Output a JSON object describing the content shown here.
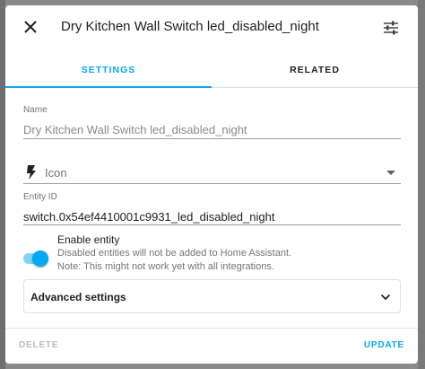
{
  "dialog": {
    "title": "Dry Kitchen Wall Switch led_disabled_night",
    "close_icon": "close-icon",
    "settings_icon": "tune-icon"
  },
  "tabs": [
    {
      "label": "SETTINGS",
      "active": true
    },
    {
      "label": "RELATED",
      "active": false
    }
  ],
  "form": {
    "name_label": "Name",
    "name_value": "Dry Kitchen Wall Switch led_disabled_night",
    "icon_field_icon": "lightning-bolt-icon",
    "icon_placeholder": "Icon",
    "entity_id_label": "Entity ID",
    "entity_id_value": "switch.0x54ef4410001c9931_led_disabled_night",
    "enable_entity": {
      "enabled": true,
      "label": "Enable entity",
      "description_1": "Disabled entities will not be added to Home Assistant.",
      "description_2": "Note: This might not work yet with all integrations."
    },
    "advanced_settings_label": "Advanced settings"
  },
  "footer": {
    "delete_label": "DELETE",
    "update_label": "UPDATE"
  },
  "colors": {
    "accent": "#03a9f4",
    "disabled": "#bdbdbd"
  }
}
